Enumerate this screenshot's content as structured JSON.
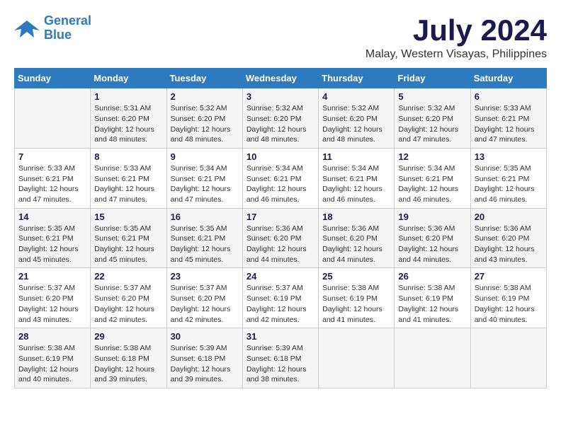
{
  "header": {
    "logo_line1": "General",
    "logo_line2": "Blue",
    "month_title": "July 2024",
    "location": "Malay, Western Visayas, Philippines"
  },
  "weekdays": [
    "Sunday",
    "Monday",
    "Tuesday",
    "Wednesday",
    "Thursday",
    "Friday",
    "Saturday"
  ],
  "weeks": [
    [
      {
        "day": "",
        "info": ""
      },
      {
        "day": "1",
        "info": "Sunrise: 5:31 AM\nSunset: 6:20 PM\nDaylight: 12 hours\nand 48 minutes."
      },
      {
        "day": "2",
        "info": "Sunrise: 5:32 AM\nSunset: 6:20 PM\nDaylight: 12 hours\nand 48 minutes."
      },
      {
        "day": "3",
        "info": "Sunrise: 5:32 AM\nSunset: 6:20 PM\nDaylight: 12 hours\nand 48 minutes."
      },
      {
        "day": "4",
        "info": "Sunrise: 5:32 AM\nSunset: 6:20 PM\nDaylight: 12 hours\nand 48 minutes."
      },
      {
        "day": "5",
        "info": "Sunrise: 5:32 AM\nSunset: 6:20 PM\nDaylight: 12 hours\nand 47 minutes."
      },
      {
        "day": "6",
        "info": "Sunrise: 5:33 AM\nSunset: 6:21 PM\nDaylight: 12 hours\nand 47 minutes."
      }
    ],
    [
      {
        "day": "7",
        "info": "Sunrise: 5:33 AM\nSunset: 6:21 PM\nDaylight: 12 hours\nand 47 minutes."
      },
      {
        "day": "8",
        "info": "Sunrise: 5:33 AM\nSunset: 6:21 PM\nDaylight: 12 hours\nand 47 minutes."
      },
      {
        "day": "9",
        "info": "Sunrise: 5:34 AM\nSunset: 6:21 PM\nDaylight: 12 hours\nand 47 minutes."
      },
      {
        "day": "10",
        "info": "Sunrise: 5:34 AM\nSunset: 6:21 PM\nDaylight: 12 hours\nand 46 minutes."
      },
      {
        "day": "11",
        "info": "Sunrise: 5:34 AM\nSunset: 6:21 PM\nDaylight: 12 hours\nand 46 minutes."
      },
      {
        "day": "12",
        "info": "Sunrise: 5:34 AM\nSunset: 6:21 PM\nDaylight: 12 hours\nand 46 minutes."
      },
      {
        "day": "13",
        "info": "Sunrise: 5:35 AM\nSunset: 6:21 PM\nDaylight: 12 hours\nand 46 minutes."
      }
    ],
    [
      {
        "day": "14",
        "info": "Sunrise: 5:35 AM\nSunset: 6:21 PM\nDaylight: 12 hours\nand 45 minutes."
      },
      {
        "day": "15",
        "info": "Sunrise: 5:35 AM\nSunset: 6:21 PM\nDaylight: 12 hours\nand 45 minutes."
      },
      {
        "day": "16",
        "info": "Sunrise: 5:35 AM\nSunset: 6:21 PM\nDaylight: 12 hours\nand 45 minutes."
      },
      {
        "day": "17",
        "info": "Sunrise: 5:36 AM\nSunset: 6:20 PM\nDaylight: 12 hours\nand 44 minutes."
      },
      {
        "day": "18",
        "info": "Sunrise: 5:36 AM\nSunset: 6:20 PM\nDaylight: 12 hours\nand 44 minutes."
      },
      {
        "day": "19",
        "info": "Sunrise: 5:36 AM\nSunset: 6:20 PM\nDaylight: 12 hours\nand 44 minutes."
      },
      {
        "day": "20",
        "info": "Sunrise: 5:36 AM\nSunset: 6:20 PM\nDaylight: 12 hours\nand 43 minutes."
      }
    ],
    [
      {
        "day": "21",
        "info": "Sunrise: 5:37 AM\nSunset: 6:20 PM\nDaylight: 12 hours\nand 43 minutes."
      },
      {
        "day": "22",
        "info": "Sunrise: 5:37 AM\nSunset: 6:20 PM\nDaylight: 12 hours\nand 42 minutes."
      },
      {
        "day": "23",
        "info": "Sunrise: 5:37 AM\nSunset: 6:20 PM\nDaylight: 12 hours\nand 42 minutes."
      },
      {
        "day": "24",
        "info": "Sunrise: 5:37 AM\nSunset: 6:19 PM\nDaylight: 12 hours\nand 42 minutes."
      },
      {
        "day": "25",
        "info": "Sunrise: 5:38 AM\nSunset: 6:19 PM\nDaylight: 12 hours\nand 41 minutes."
      },
      {
        "day": "26",
        "info": "Sunrise: 5:38 AM\nSunset: 6:19 PM\nDaylight: 12 hours\nand 41 minutes."
      },
      {
        "day": "27",
        "info": "Sunrise: 5:38 AM\nSunset: 6:19 PM\nDaylight: 12 hours\nand 40 minutes."
      }
    ],
    [
      {
        "day": "28",
        "info": "Sunrise: 5:38 AM\nSunset: 6:19 PM\nDaylight: 12 hours\nand 40 minutes."
      },
      {
        "day": "29",
        "info": "Sunrise: 5:38 AM\nSunset: 6:18 PM\nDaylight: 12 hours\nand 39 minutes."
      },
      {
        "day": "30",
        "info": "Sunrise: 5:39 AM\nSunset: 6:18 PM\nDaylight: 12 hours\nand 39 minutes."
      },
      {
        "day": "31",
        "info": "Sunrise: 5:39 AM\nSunset: 6:18 PM\nDaylight: 12 hours\nand 38 minutes."
      },
      {
        "day": "",
        "info": ""
      },
      {
        "day": "",
        "info": ""
      },
      {
        "day": "",
        "info": ""
      }
    ]
  ]
}
